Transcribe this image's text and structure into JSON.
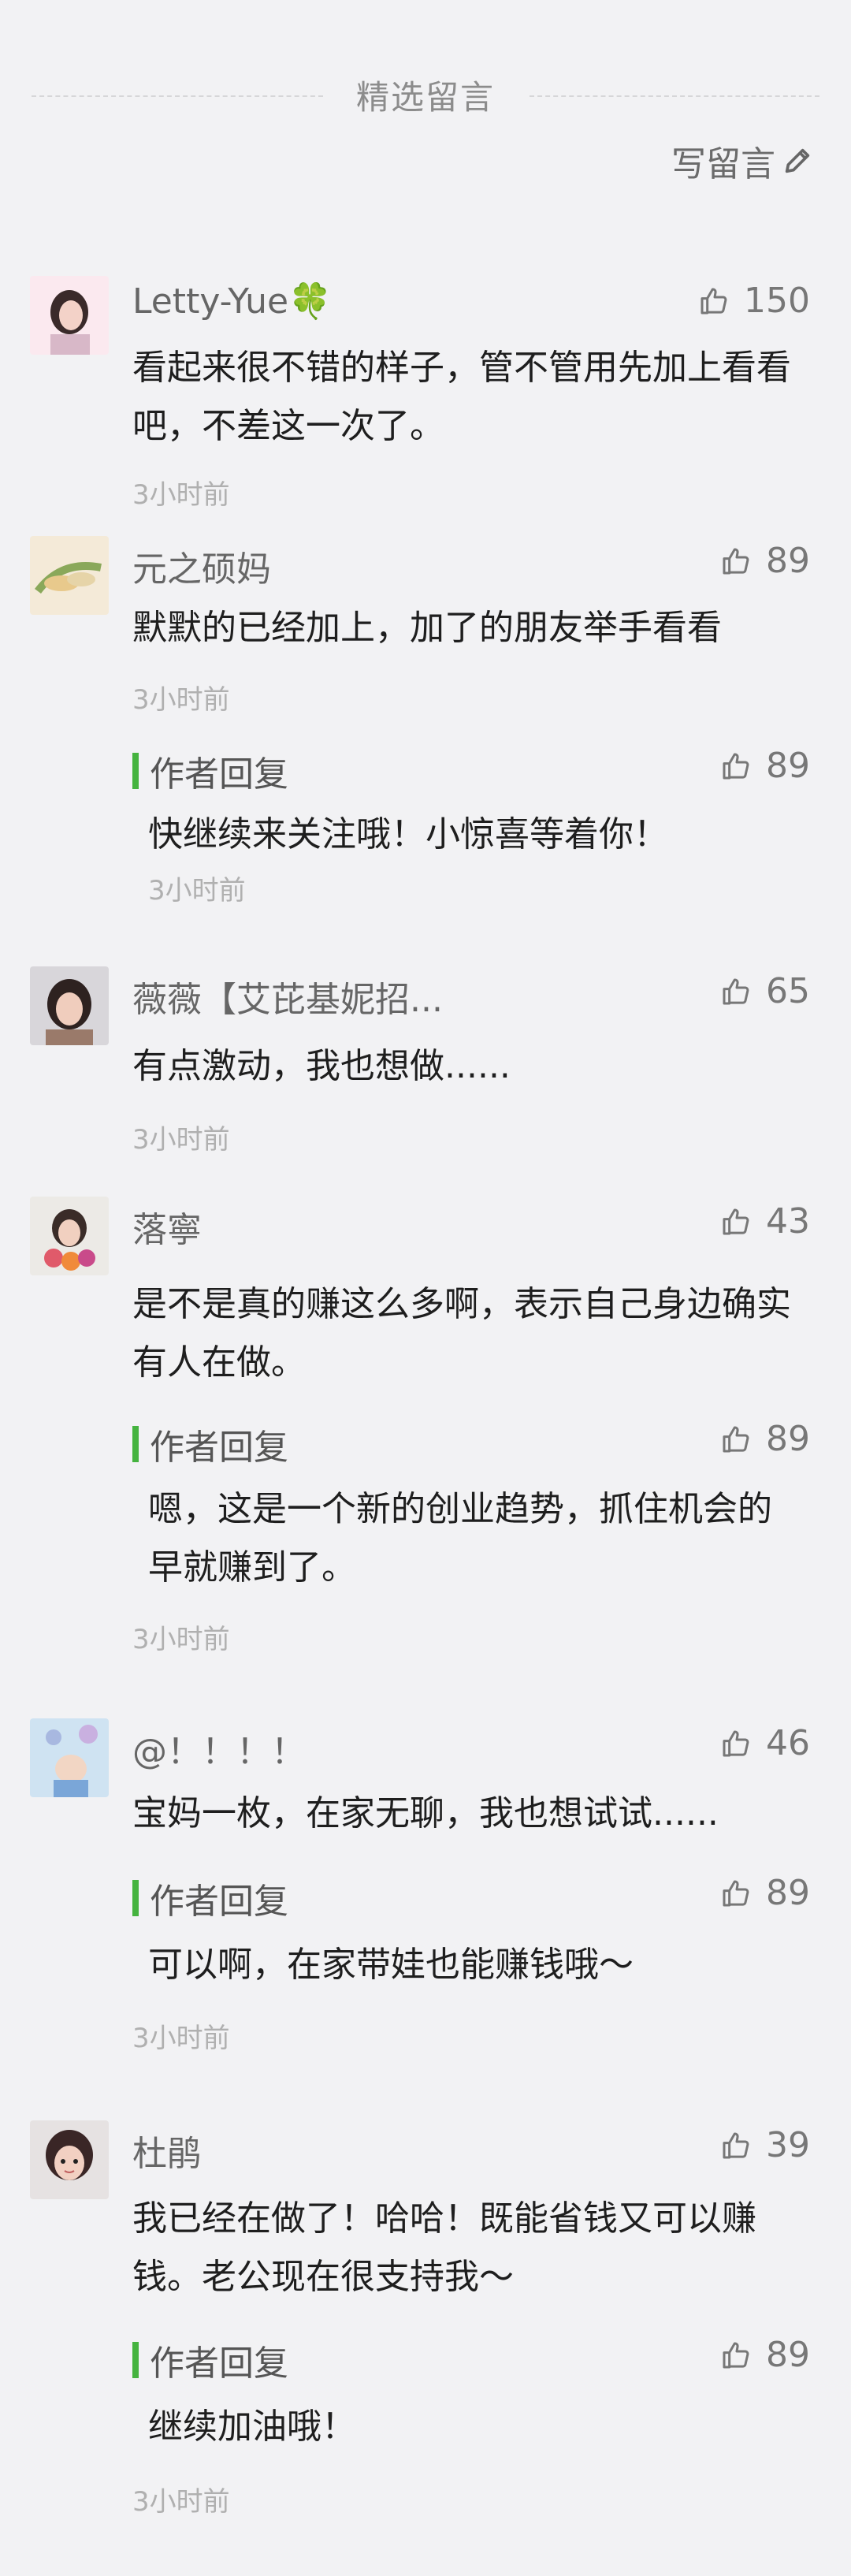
{
  "header": {
    "title": "精选留言",
    "write_label": "写留言"
  },
  "comments": [
    {
      "name": "Letty-Yue🍀",
      "likes": "150",
      "text": "看起来很不错的样子，管不管用先加上看看吧，不差这一次了。",
      "time": "3小时前"
    },
    {
      "name": "元之硕妈",
      "likes": "89",
      "text": "默默的已经加上，加了的朋友举手看看",
      "time": "3小时前",
      "reply": {
        "label": "作者回复",
        "likes": "89",
        "text": "快继续来关注哦！小惊喜等着你！",
        "time": "3小时前"
      }
    },
    {
      "name": "薇薇【艾芘基妮招...",
      "likes": "65",
      "text": "有点激动，我也想做......",
      "time": "3小时前"
    },
    {
      "name": "落寧",
      "likes": "43",
      "text": "是不是真的赚这么多啊，表示自己身边确实有人在做。",
      "time": "3小时前",
      "reply": {
        "label": "作者回复",
        "likes": "89",
        "text": "嗯，这是一个新的创业趋势，抓住机会的早就赚到了。"
      }
    },
    {
      "name": "@！！！！",
      "likes": "46",
      "text": "宝妈一枚，在家无聊，我也想试试......",
      "time": "3小时前",
      "reply": {
        "label": "作者回复",
        "likes": "89",
        "text": "可以啊，在家带娃也能赚钱哦～"
      }
    },
    {
      "name": "杜鹃",
      "likes": "39",
      "text": "我已经在做了！哈哈！既能省钱又可以赚钱。老公现在很支持我～",
      "time": "3小时前",
      "reply": {
        "label": "作者回复",
        "likes": "89",
        "text": "继续加油哦！"
      }
    }
  ],
  "icons": {
    "like": "thumbs-up-icon",
    "write": "pencil-icon"
  },
  "colors": {
    "reply_accent": "#45b33f"
  }
}
